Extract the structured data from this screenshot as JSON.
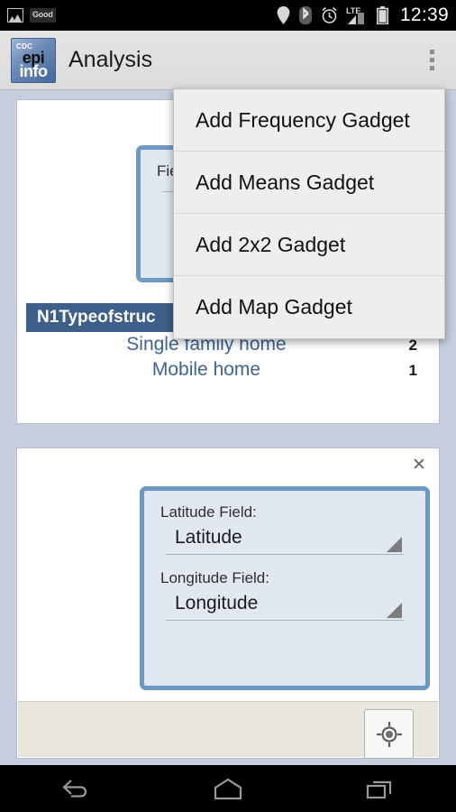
{
  "statusbar": {
    "icons_left": [
      "image-icon",
      "good-app-badge"
    ],
    "app_badge_label": "Good",
    "icons_right": [
      "location-pin-icon",
      "bluetooth-icon",
      "alarm-clock-icon",
      "lte-signal-icon",
      "battery-icon"
    ],
    "network_label": "LTE",
    "time": "12:39"
  },
  "actionbar": {
    "logo_cdc": "CDC",
    "logo_epi": "epi",
    "logo_info": "info",
    "title": "Analysis",
    "overflow_icon": "overflow-menu-icon"
  },
  "menu": {
    "items": [
      {
        "label": "Add Frequency Gadget"
      },
      {
        "label": "Add Means Gadget"
      },
      {
        "label": "Add 2x2 Gadget"
      },
      {
        "label": "Add Map Gadget"
      }
    ]
  },
  "frequency_card": {
    "field_label": "Field:",
    "field_value": "",
    "table": {
      "header": "N1Typeofstruc",
      "rows": [
        {
          "label": "Single family home",
          "value": "2"
        },
        {
          "label": "Mobile home",
          "value": "1"
        }
      ]
    }
  },
  "map_card": {
    "close_icon": "✕",
    "latitude_label": "Latitude Field:",
    "latitude_value": "Latitude",
    "longitude_label": "Longitude Field:",
    "longitude_value": "Longitude",
    "my_location_icon": "my-location-icon"
  },
  "navbar": {
    "back": "back-icon",
    "home": "home-icon",
    "recents": "recent-apps-icon"
  },
  "colors": {
    "page_background": "#c8cedd",
    "table_header": "#3d5f8a",
    "table_row_text": "#3d6496",
    "panel_border": "#6d9ac4",
    "panel_fill": "#e2e8f2",
    "menu_background": "#eeeeee",
    "map_area": "#e8e6dd"
  }
}
